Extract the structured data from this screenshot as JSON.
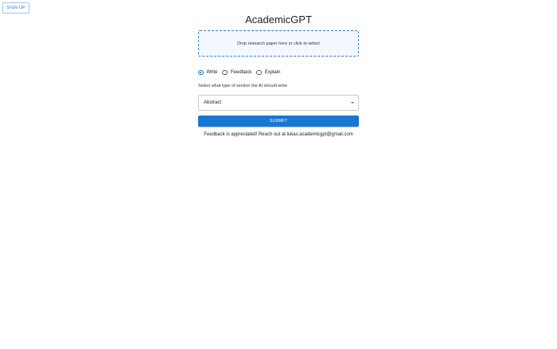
{
  "header": {
    "signup_label": "SIGN UP",
    "title": "AcademicGPT"
  },
  "upload": {
    "prompt": "Drop research paper here or click to select"
  },
  "modes": [
    {
      "label": "Write",
      "selected": true
    },
    {
      "label": "Feedback",
      "selected": false
    },
    {
      "label": "Explain",
      "selected": false
    }
  ],
  "section_select": {
    "label": "Select what type of section the AI should write",
    "value": "Abstract"
  },
  "submit_label": "SUBMIT",
  "footer": {
    "note": "Feedback is appreciated! Reach out at lukas.academicgpt@gmail.com"
  },
  "colors": {
    "accent": "#1976d2",
    "dropzone_bg": "#f2f8fe"
  }
}
